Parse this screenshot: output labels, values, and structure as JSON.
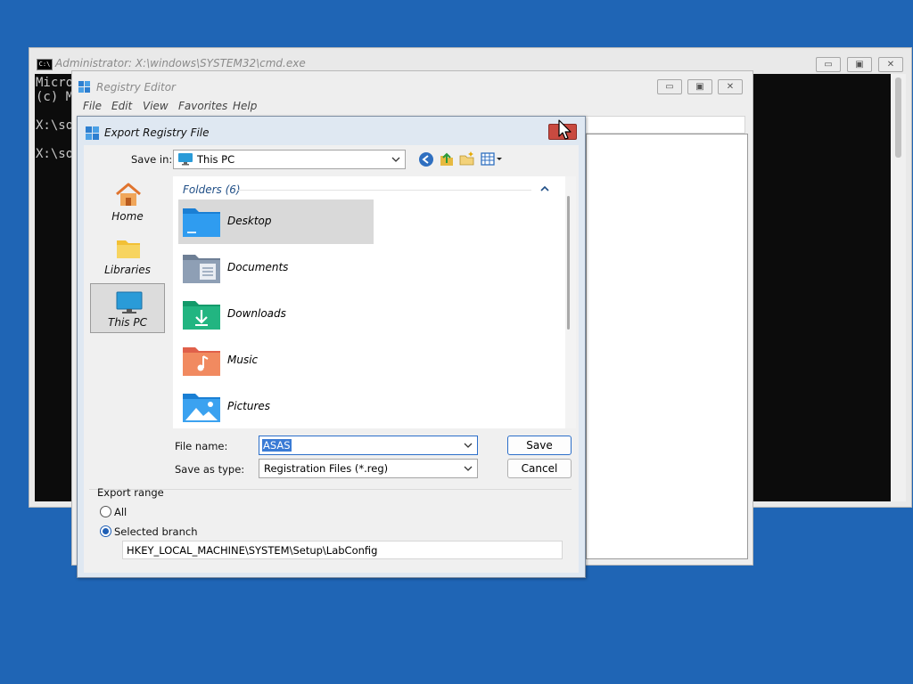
{
  "cmd": {
    "title": "Administrator: X:\\windows\\SYSTEM32\\cmd.exe",
    "icon_text": "C:\\",
    "lines": [
      "Micro",
      "(c) M",
      "",
      "X:\\so",
      "",
      "X:\\so"
    ]
  },
  "regedit": {
    "title": "Registry Editor",
    "menu": [
      "File",
      "Edit",
      "View",
      "Favorites",
      "Help"
    ]
  },
  "dialog": {
    "title": "Export Registry File",
    "close_glyph": "✕",
    "save_in_label": "Save in:",
    "save_in_value": "This PC",
    "places": [
      {
        "label": "Home",
        "icon": "home-icon"
      },
      {
        "label": "Libraries",
        "icon": "libraries-icon"
      },
      {
        "label": "This PC",
        "icon": "this-pc-icon",
        "active": true
      }
    ],
    "group_header": "Folders (6)",
    "folders": [
      {
        "name": "Desktop",
        "icon": "desktop-folder-icon",
        "selected": true
      },
      {
        "name": "Documents",
        "icon": "documents-folder-icon"
      },
      {
        "name": "Downloads",
        "icon": "downloads-folder-icon"
      },
      {
        "name": "Music",
        "icon": "music-folder-icon"
      },
      {
        "name": "Pictures",
        "icon": "pictures-folder-icon"
      }
    ],
    "file_name_label": "File name:",
    "file_name_value": "ASAS",
    "save_as_type_label": "Save as type:",
    "save_as_type_value": "Registration Files (*.reg)",
    "save_button": "Save",
    "cancel_button": "Cancel",
    "export_range_label": "Export range",
    "radio_all": "All",
    "radio_selected_branch": "Selected branch",
    "branch_value": "HKEY_LOCAL_MACHINE\\SYSTEM\\Setup\\LabConfig"
  },
  "colors": {
    "desktop": "#1f65b5",
    "accent": "#2b6ec9",
    "close": "#c94a40"
  }
}
